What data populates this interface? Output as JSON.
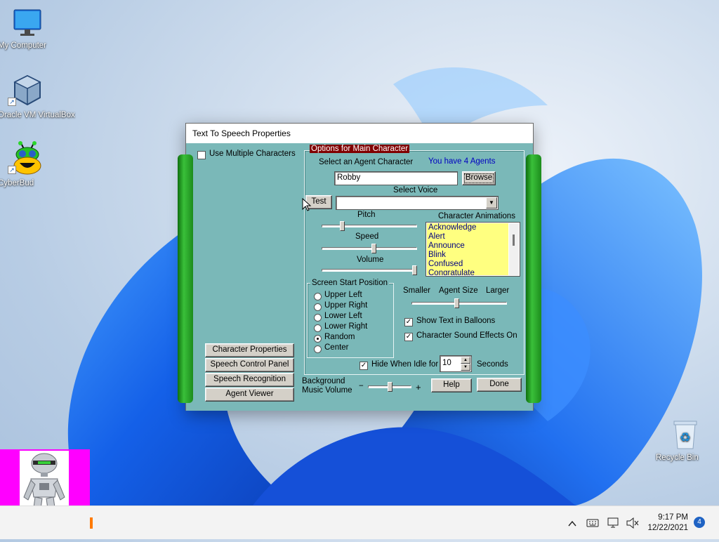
{
  "desktop": {
    "icons": [
      {
        "label": "My Computer",
        "icon": "monitor-icon"
      },
      {
        "label": "Oracle VM VirtualBox",
        "icon": "virtualbox-cube-icon"
      },
      {
        "label": "CyberBud",
        "icon": "cyberbud-alien-icon"
      },
      {
        "label": "Recycle Bin",
        "icon": "recycle-bin-icon"
      }
    ]
  },
  "dialog": {
    "title": "Text To Speech Properties",
    "use_multiple_characters": {
      "label": "Use Multiple Characters",
      "checked": false
    },
    "options_group_title": "Options for Main Character",
    "select_agent_label": "Select an Agent Character",
    "agents_count_text": "You have 4 Agents",
    "agent_value": "Robby",
    "browse_button": "Browse",
    "select_voice_label": "Select Voice",
    "test_button": "Test",
    "voice_value": "",
    "pitch_label": "Pitch",
    "pitch_level": 0.2,
    "speed_label": "Speed",
    "speed_level": 0.55,
    "volume_label": "Volume",
    "volume_level": 1.0,
    "animations_label": "Character Animations",
    "animations": [
      "Acknowledge",
      "Alert",
      "Announce",
      "Blink",
      "Confused",
      "Congratulate"
    ],
    "screen_start": {
      "title": "Screen Start Position",
      "options": [
        "Upper Left",
        "Upper Right",
        "Lower Left",
        "Lower Right",
        "Random",
        "Center"
      ],
      "selected": "Random"
    },
    "size_smaller": "Smaller",
    "size_label": "Agent Size",
    "size_larger": "Larger",
    "size_level": 0.47,
    "show_text_balloons": {
      "label": "Show Text in Balloons",
      "checked": true
    },
    "sound_effects": {
      "label": "Character Sound Effects On",
      "checked": true
    },
    "hide_when_idle": {
      "label": "Hide When Idle for",
      "checked": true,
      "value": "10",
      "unit": "Seconds"
    },
    "left_buttons": [
      "Character Properties",
      "Speech Control Panel",
      "Speech Recognition",
      "Agent Viewer"
    ],
    "music_volume_label_1": "Background",
    "music_volume_label_2": "Music Volume",
    "music_minus": "−",
    "music_plus": "+",
    "music_level": 0.5,
    "help_button": "Help",
    "done_button": "Done"
  },
  "taskbar": {
    "time": "9:17 PM",
    "date": "12/22/2021",
    "notification_count": "4"
  },
  "colors": {
    "dialog_bg": "#7ab8b8",
    "group_title_bg": "#800000",
    "agents_text": "#0000c0",
    "animation_list_bg": "#ffff80",
    "cyberbud_bg": "#ff00ff",
    "green_frame": "#1d8c1d"
  }
}
